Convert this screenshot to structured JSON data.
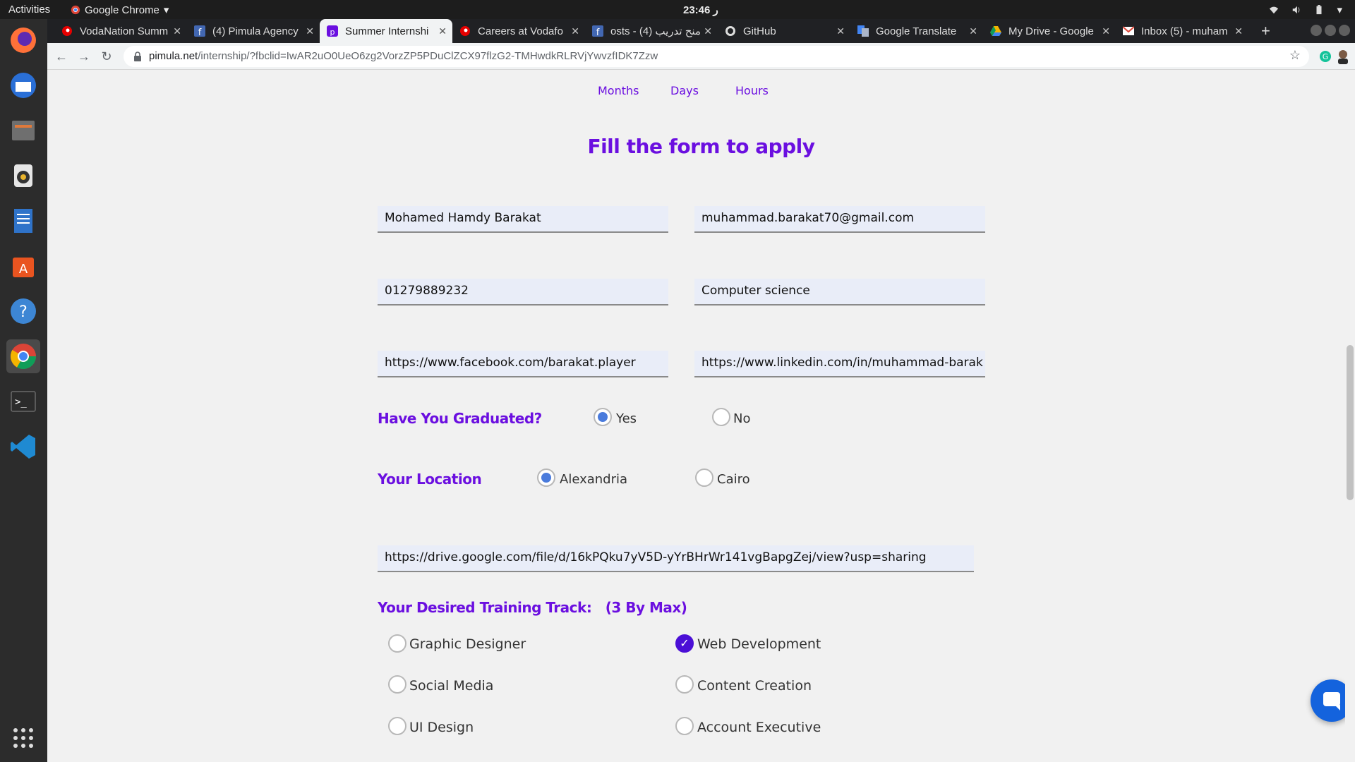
{
  "topbar": {
    "activities": "Activities",
    "app_name": "Google Chrome",
    "clock": "23:46 ر"
  },
  "dock": {
    "items": [
      "firefox-icon",
      "thunderbird-icon",
      "files-icon",
      "rhythmbox-icon",
      "writer-icon",
      "software-center-icon",
      "help-icon",
      "chrome-icon",
      "terminal-icon",
      "vscode-icon",
      "app-grid-icon"
    ]
  },
  "tabs": [
    {
      "title": "VodaNation Summ",
      "favicon": "vodafone-icon"
    },
    {
      "title": "(4) Pimula Agency",
      "favicon": "facebook-icon"
    },
    {
      "title": "Summer Internshi",
      "favicon": "pimula-icon",
      "active": true
    },
    {
      "title": "Careers at Vodafo",
      "favicon": "vodafone-icon"
    },
    {
      "title": "osts - منح تدريب (4)",
      "favicon": "facebook-icon"
    },
    {
      "title": "GitHub",
      "favicon": "github-icon"
    },
    {
      "title": "Google Translate",
      "favicon": "translate-icon"
    },
    {
      "title": "My Drive - Google",
      "favicon": "drive-icon"
    },
    {
      "title": "Inbox (5) - muham",
      "favicon": "gmail-icon"
    }
  ],
  "address_bar": {
    "domain": "pimula.net",
    "path": "/internship/?fbclid=IwAR2uO0UeO6zg2VorzZP5PDuClZCX97flzG2-TMHwdkRLRVjYwvzfIDK7Zzw"
  },
  "countdown_units": [
    "Months",
    "Days",
    "Hours"
  ],
  "form": {
    "title": "Fill the form to apply",
    "name": "Mohamed Hamdy Barakat",
    "email": "muhammad.barakat70@gmail.com",
    "phone": "01279889232",
    "major": "Computer science",
    "facebook": "https://www.facebook.com/barakat.player",
    "linkedin": "https://www.linkedin.com/in/muhammad-barak",
    "graduated_label": "Have You Graduated?",
    "graduated_options": [
      "Yes",
      "No"
    ],
    "graduated_selected": "Yes",
    "location_label": "Your Location",
    "location_options": [
      "Alexandria",
      "Cairo"
    ],
    "location_selected": "Alexandria",
    "cv_link": "https://drive.google.com/file/d/16kPQku7yV5D-yYrBHrWr141vgBapgZej/view?usp=sharing",
    "track_label": "Your Desired Training Track:",
    "track_max": "(3 By Max)",
    "tracks": [
      "Graphic Designer",
      "Web Development",
      "Social Media",
      "Content Creation",
      "UI Design",
      "Account Executive"
    ],
    "tracks_checked": [
      "Web Development"
    ]
  },
  "colors": {
    "accent_purple": "#6b0fe0",
    "radio_blue": "#4a7bdc",
    "fab_blue": "#1463dd"
  }
}
